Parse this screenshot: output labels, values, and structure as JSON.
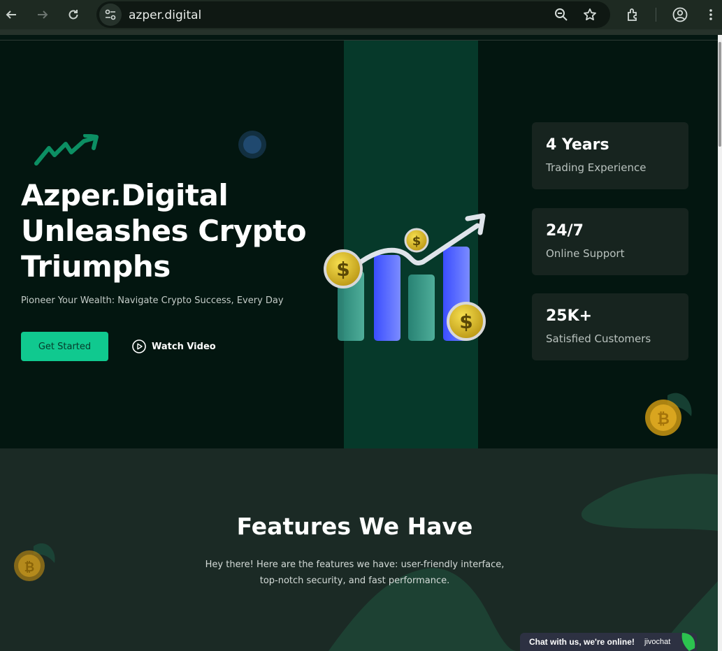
{
  "browser": {
    "url": "azper.digital",
    "icons": [
      "back-icon",
      "forward-icon",
      "reload-icon",
      "site-settings-icon",
      "zoom-icon",
      "bookmark-star-icon",
      "extensions-icon",
      "profile-icon"
    ]
  },
  "hero": {
    "title": "Azper.Digital Unleashes Crypto Triumphs",
    "subtitle": "Pioneer Your Wealth: Navigate Crypto Success, Every Day",
    "cta_label": "Get Started",
    "video_label": "Watch Video",
    "stats": [
      {
        "value": "4 Years",
        "label": "Trading Experience"
      },
      {
        "value": "24/7",
        "label": "Online Support"
      },
      {
        "value": "25K+",
        "label": "Satisfied Customers"
      }
    ]
  },
  "features": {
    "title": "Features We Have",
    "description": "Hey there! Here are the features we have: user-friendly interface, top-notch security, and fast performance."
  },
  "chat": {
    "label": "Chat with us, we're online!",
    "brand": "jivochat"
  },
  "colors": {
    "accent": "#10c98f",
    "hero_bg": "#031610",
    "section_bg": "#1b2a25"
  }
}
